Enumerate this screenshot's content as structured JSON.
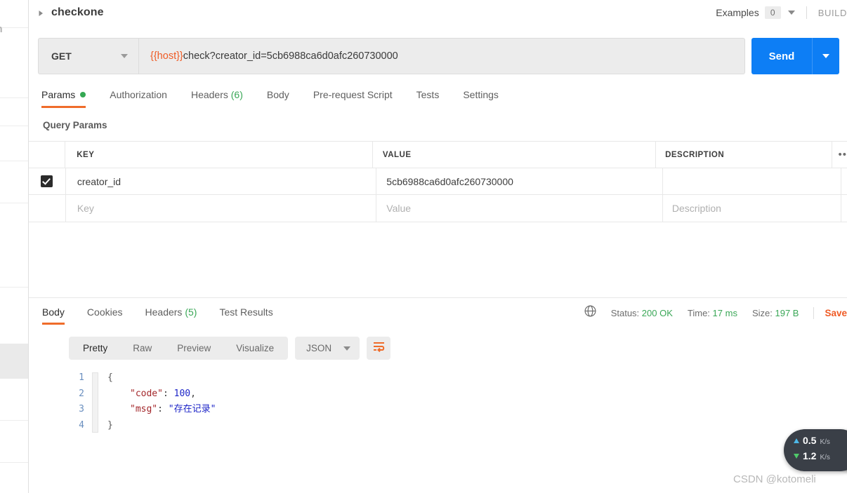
{
  "left_strip": {
    "partial_label": "sh"
  },
  "request": {
    "title": "checkone",
    "disclosure_icon": "triangle-right-icon",
    "examples_label": "Examples",
    "examples_count": "0",
    "examples_caret_icon": "chevron-down-icon",
    "build_label": "BUILD",
    "method": "GET",
    "method_caret_icon": "chevron-down-icon",
    "url_variable": "{{host}}",
    "url_rest": "check?creator_id=5cb6988ca6d0afc260730000",
    "send_label": "Send",
    "send_caret_icon": "chevron-down-icon",
    "tabs": [
      {
        "label": "Params",
        "dot": true,
        "active": true
      },
      {
        "label": "Authorization",
        "active": false
      },
      {
        "label": "Headers",
        "count": "(6)",
        "active": false
      },
      {
        "label": "Body",
        "active": false
      },
      {
        "label": "Pre-request Script",
        "active": false
      },
      {
        "label": "Tests",
        "active": false
      },
      {
        "label": "Settings",
        "active": false
      }
    ]
  },
  "query_params": {
    "section_title": "Query Params",
    "columns": [
      "KEY",
      "VALUE",
      "DESCRIPTION"
    ],
    "more_icon": "ellipsis-icon",
    "rows": [
      {
        "checked": true,
        "key": "creator_id",
        "value": "5cb6988ca6d0afc260730000",
        "description": ""
      }
    ],
    "placeholder_row": {
      "key": "Key",
      "value": "Value",
      "description": "Description"
    }
  },
  "response": {
    "tabs": [
      {
        "label": "Body",
        "active": true
      },
      {
        "label": "Cookies",
        "active": false
      },
      {
        "label": "Headers",
        "count": "(5)",
        "active": false
      },
      {
        "label": "Test Results",
        "active": false
      }
    ],
    "globe_icon": "globe-icon",
    "status_label": "Status:",
    "status_value": "200 OK",
    "time_label": "Time:",
    "time_value": "17 ms",
    "size_label": "Size:",
    "size_value": "197 B",
    "save_label": "Save",
    "view_modes": [
      {
        "label": "Pretty",
        "active": true
      },
      {
        "label": "Raw",
        "active": false
      },
      {
        "label": "Preview",
        "active": false
      },
      {
        "label": "Visualize",
        "active": false
      }
    ],
    "format": "JSON",
    "format_caret_icon": "chevron-down-icon",
    "wrap_icon": "word-wrap-icon",
    "code": {
      "line_numbers": [
        "1",
        "2",
        "3",
        "4"
      ],
      "body": {
        "open_brace": "{",
        "entries": [
          {
            "key": "\"code\"",
            "sep": ": ",
            "value": "100",
            "trailing": ","
          },
          {
            "key": "\"msg\"",
            "sep": ": ",
            "value": "\"存在记录\"",
            "trailing": ""
          }
        ],
        "close_brace": "}"
      }
    }
  },
  "net_widget": {
    "upload_icon": "arrow-up-icon",
    "upload_value": "0.5",
    "upload_unit": "K/s",
    "download_icon": "arrow-down-icon",
    "download_value": "1.2",
    "download_unit": "K/s"
  },
  "watermark": "CSDN @kotomeli",
  "colors": {
    "accent_orange": "#ef6c2a",
    "send_blue": "#0d7ef5",
    "status_green": "#3aa757",
    "var_orange": "#ef5b25"
  }
}
